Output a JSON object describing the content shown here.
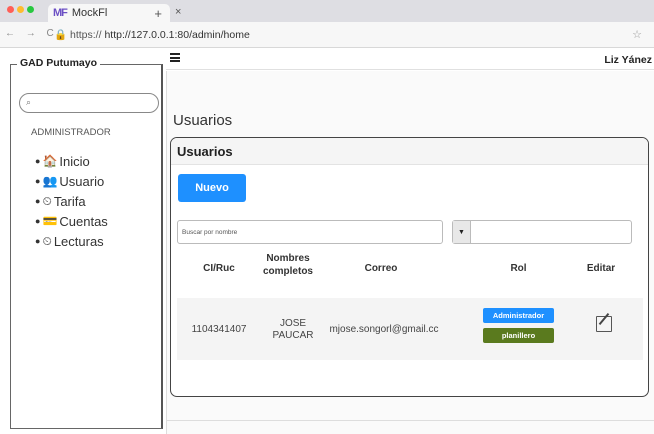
{
  "browser": {
    "tab_title": "MockFl",
    "tab_logo": "MF",
    "new_tab": "+",
    "close_tab": "×",
    "nav_icons": "← → C",
    "url_prefix": "🔒 https://",
    "url": "http://127.0.0.1:80/admin/home",
    "bookmark_icon": "☆",
    "traffic_lights": [
      "#ff5f57",
      "#febc2e",
      "#28c840"
    ]
  },
  "sidebar": {
    "title": "GAD Putumayo",
    "search_icon": "⌕",
    "search_placeholder": "",
    "role": "ADMINISTRADOR",
    "items": [
      {
        "icon": "home-icon",
        "glyph": "🏠",
        "label": "Inicio"
      },
      {
        "icon": "users-icon",
        "glyph": "👥",
        "label": "Usuario"
      },
      {
        "icon": "tachometer-icon",
        "glyph": "⏲",
        "label": "Tarifa"
      },
      {
        "icon": "wallet-icon",
        "glyph": "💳",
        "label": "Cuentas"
      },
      {
        "icon": "tachometer-icon",
        "glyph": "⏲",
        "label": "Lecturas"
      }
    ]
  },
  "header": {
    "user_name": "Liz Yánez"
  },
  "main": {
    "page_title": "Usuarios",
    "card_title": "Usuarios",
    "new_button": "Nuevo",
    "search_placeholder": "Buscar por nombre",
    "select_value": "",
    "select_caret": "▼",
    "columns": [
      "CI/Ruc",
      "Nombres completos",
      "Correo",
      "Rol",
      "Editar"
    ],
    "rows": [
      {
        "ci": "1104341407",
        "name_line1": "JOSE",
        "name_line2": "PAUCAR",
        "email": "mjose.songorl@gmail.cc",
        "roles": [
          "Administrador",
          "planillero"
        ]
      }
    ],
    "colors": {
      "primary": "#1e90ff",
      "role_admin": "#1e90ff",
      "role_planillero": "#5a7a1e"
    }
  }
}
